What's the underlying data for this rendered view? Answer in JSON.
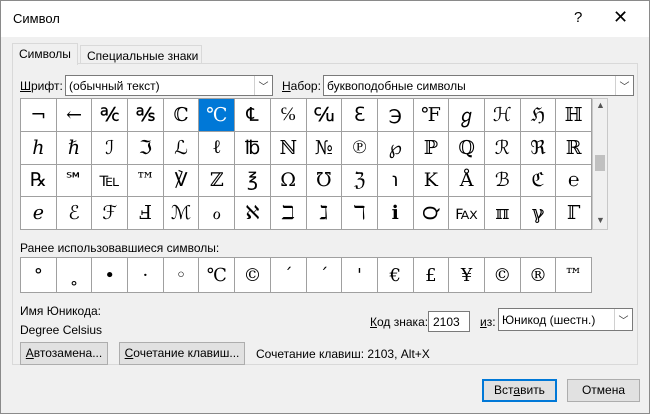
{
  "window": {
    "title": "Символ",
    "help_label": "?",
    "close_label": "✕"
  },
  "tabs": [
    {
      "label": "Символы",
      "active": true
    },
    {
      "label": "Специальные знаки",
      "active": false
    }
  ],
  "font": {
    "label_prefix": "Ш",
    "label_rest": "рифт:",
    "value": "(обычный текст)"
  },
  "subset": {
    "label_prefix": "Н",
    "label_rest": "абор:",
    "value": "буквоподобные символы"
  },
  "symbol_grid": {
    "selected_index": 5,
    "cells": [
      "¬",
      "←",
      "℀",
      "℁",
      "ℂ",
      "℃",
      "℄",
      "℅",
      "℆",
      "ℇ",
      "℈",
      "℉",
      "ℊ",
      "ℋ",
      "ℌ",
      "ℍ",
      "ℎ",
      "ℏ",
      "ℐ",
      "ℑ",
      "ℒ",
      "ℓ",
      "℔",
      "ℕ",
      "№",
      "℗",
      "℘",
      "ℙ",
      "ℚ",
      "ℛ",
      "ℜ",
      "ℝ",
      "℞",
      "℠",
      "℡",
      "™",
      "℣",
      "ℤ",
      "℥",
      "Ω",
      "℧",
      "ℨ",
      "℩",
      "K",
      "Å",
      "ℬ",
      "ℭ",
      "℮",
      "ℯ",
      "ℰ",
      "ℱ",
      "Ⅎ",
      "ℳ",
      "ℴ",
      "ℵ",
      "ℶ",
      "ℷ",
      "ℸ",
      "ℹ",
      "℺",
      "℻",
      "ℼ",
      "ℽ",
      "ℾ",
      "ℿ",
      "⅀",
      "⅁",
      "⅂",
      "⅃",
      "⅄",
      "ⅅ",
      "ⅆ",
      "ⅇ",
      "ⅈ",
      "ⅉ"
    ]
  },
  "recent": {
    "label": "Ранее использовавшиеся символы:",
    "cells": [
      "°",
      "˳",
      "•",
      "·",
      "◦",
      "℃",
      "©",
      "´",
      "ˊ",
      "'",
      "€",
      "£",
      "¥",
      "©",
      "®",
      "™",
      "±",
      "≠",
      "≤"
    ]
  },
  "unicode_name": {
    "label": "Имя Юникода:",
    "value": "Degree Celsius"
  },
  "char_code": {
    "label_prefix": "К",
    "label_rest": "од знака:",
    "value": "2103"
  },
  "from": {
    "label_prefix": "и",
    "label_rest": "з:",
    "value": "Юникод (шестн.)"
  },
  "buttons": {
    "autocorrect_prefix": "А",
    "autocorrect_rest": "втозамена...",
    "shortcut_prefix": "С",
    "shortcut_rest": "очетание клавиш...",
    "insert_prefix": "Вст",
    "insert_mid": "а",
    "insert_rest": "вить",
    "cancel": "Отмена"
  },
  "shortcut_text": "Сочетание клавиш: 2103, Alt+X"
}
